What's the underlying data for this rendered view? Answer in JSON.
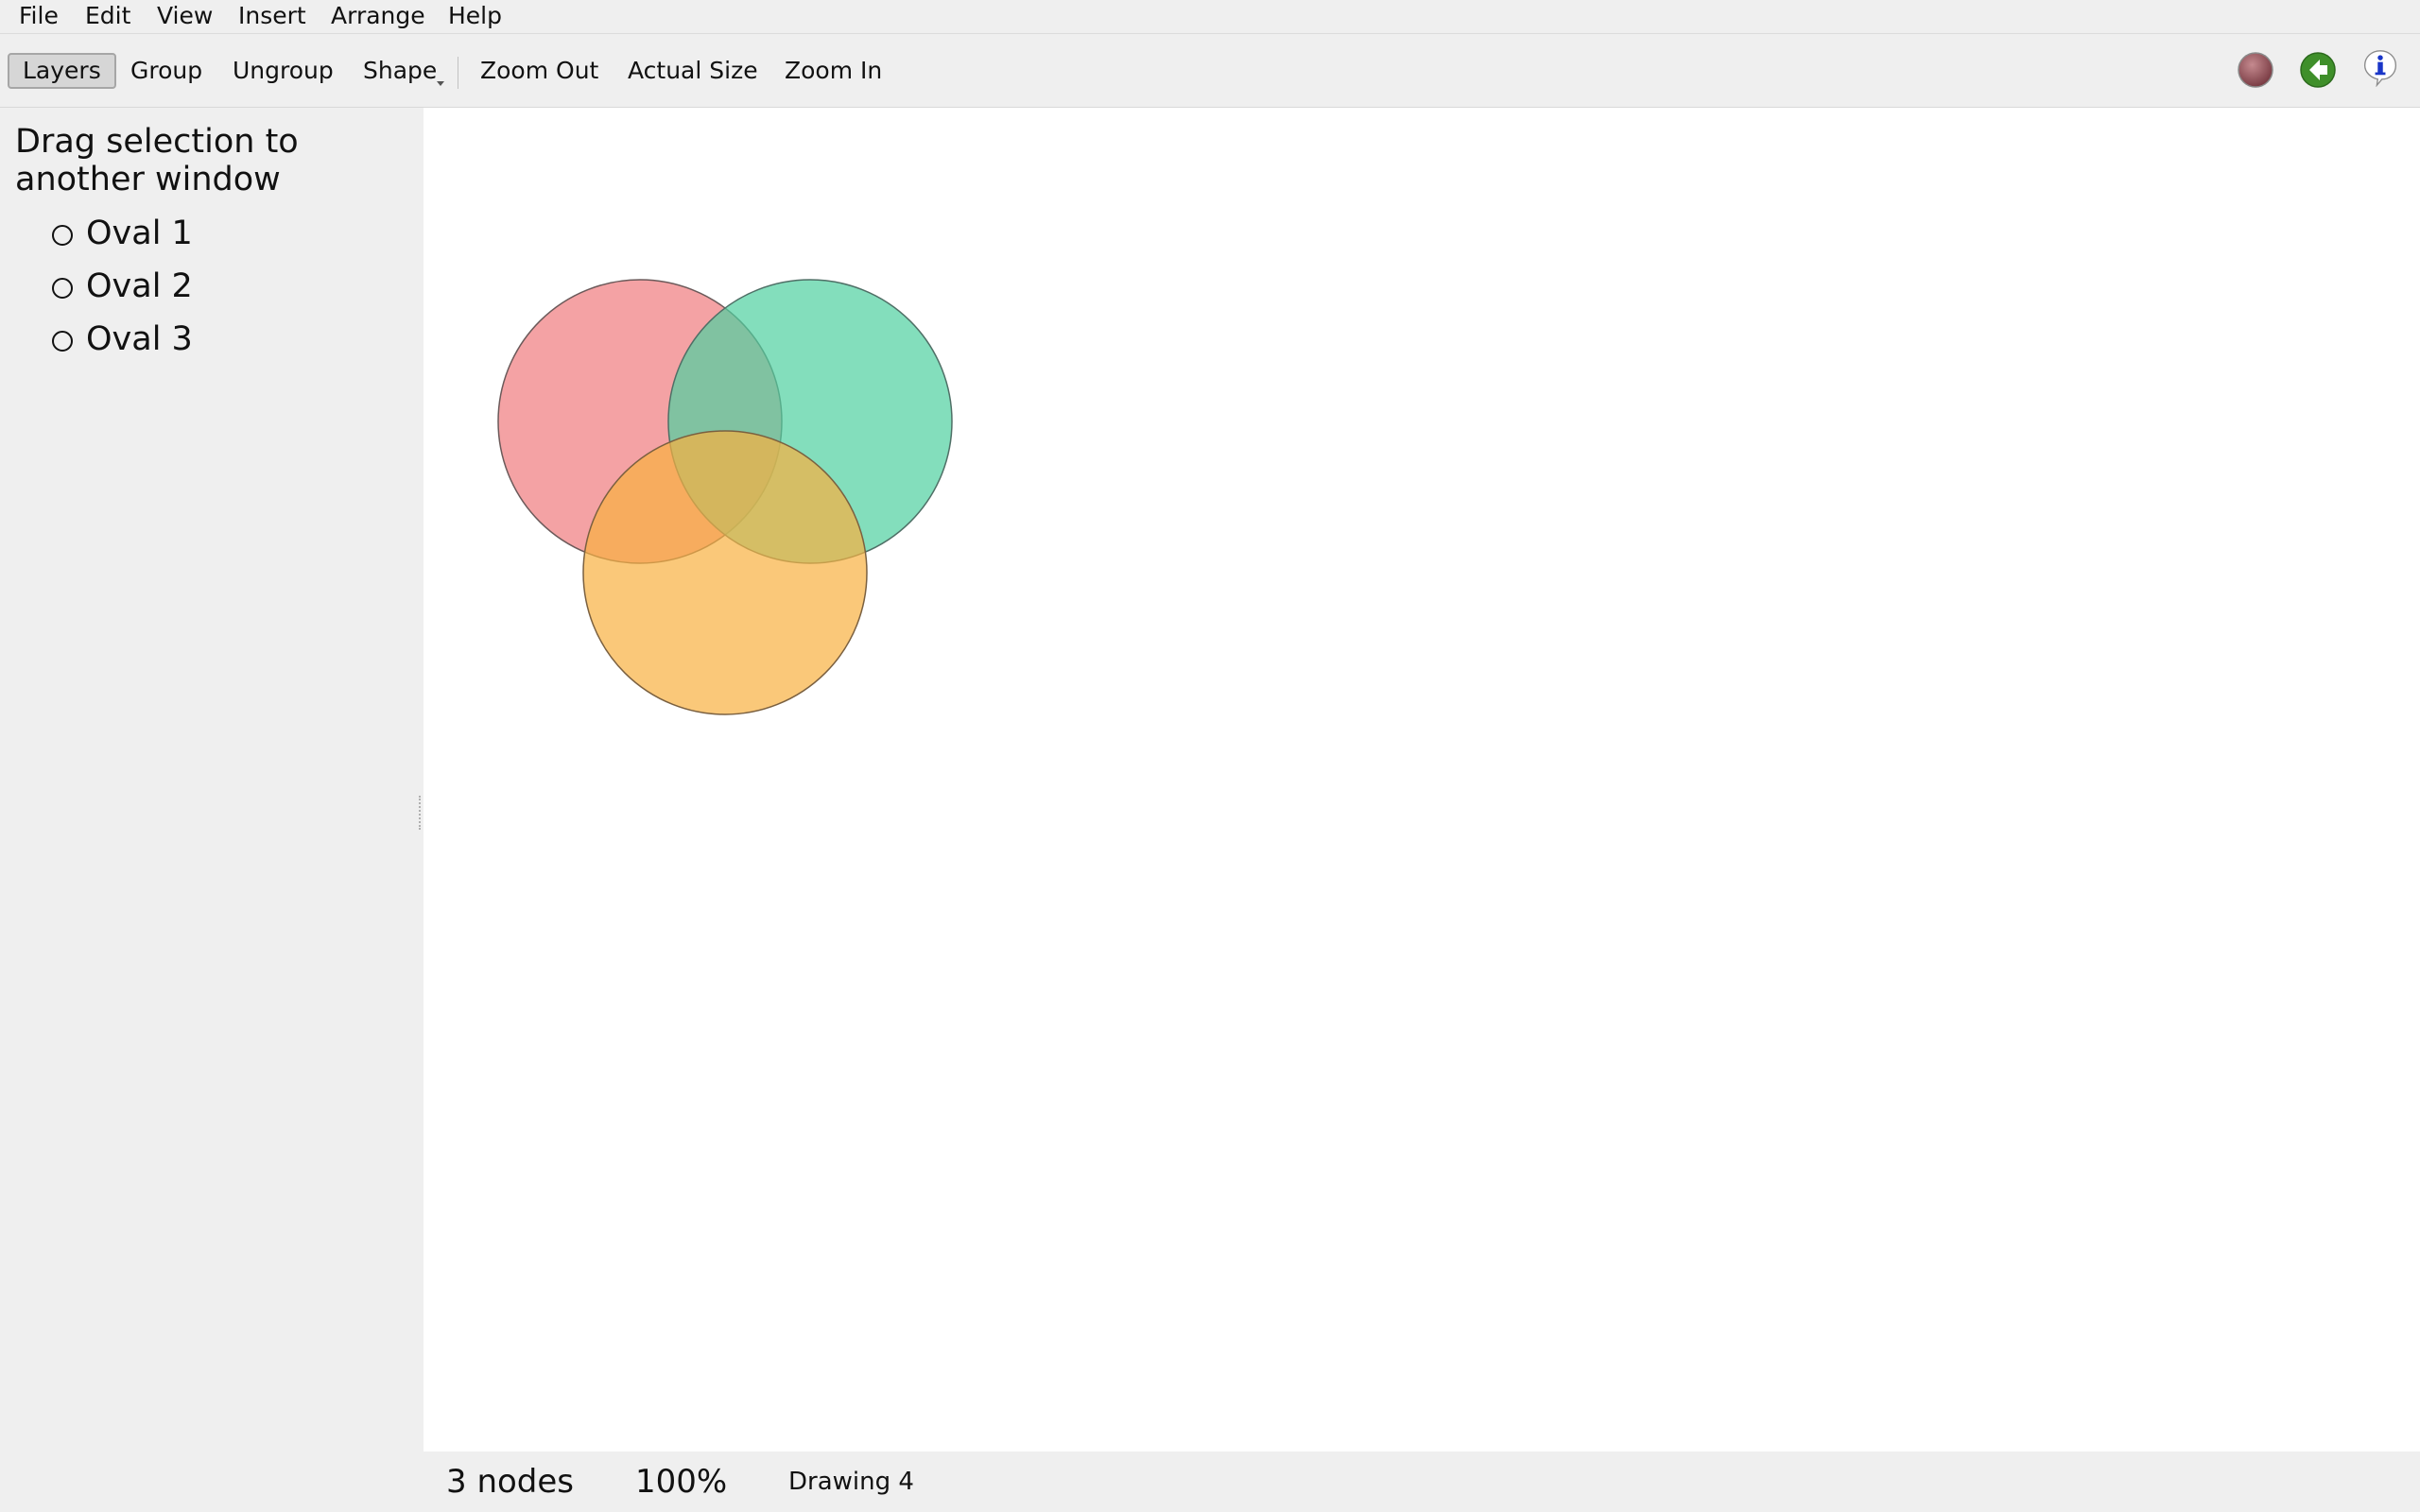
{
  "menu": {
    "items": [
      "File",
      "Edit",
      "View",
      "Insert",
      "Arrange",
      "Help"
    ]
  },
  "toolbar": {
    "layers_label": "Layers",
    "group_label": "Group",
    "ungroup_label": "Ungroup",
    "shape_label": "Shape",
    "zoom_out_label": "Zoom Out",
    "actual_size_label": "Actual Size",
    "zoom_in_label": "Zoom In",
    "icons": [
      "record-icon",
      "back-arrow-icon",
      "info-icon"
    ],
    "colors": {
      "record": "#a0545c",
      "back": "#3f8f2a",
      "info": "#1a36c8"
    }
  },
  "sidebar": {
    "title": "Drag selection to another window",
    "layers": [
      "Oval 1",
      "Oval 2",
      "Oval 3"
    ]
  },
  "canvas": {
    "shapes": [
      {
        "name": "Oval 1",
        "fill": "#ef7b7e",
        "stroke": "#6b5a5a"
      },
      {
        "name": "Oval 2",
        "fill": "#4fd0a0",
        "stroke": "#4f6f66"
      },
      {
        "name": "Oval 3",
        "fill": "#f8b040",
        "stroke": "#7a6040"
      }
    ]
  },
  "status": {
    "nodes": "3 nodes",
    "zoom": "100%",
    "document": "Drawing 4"
  }
}
